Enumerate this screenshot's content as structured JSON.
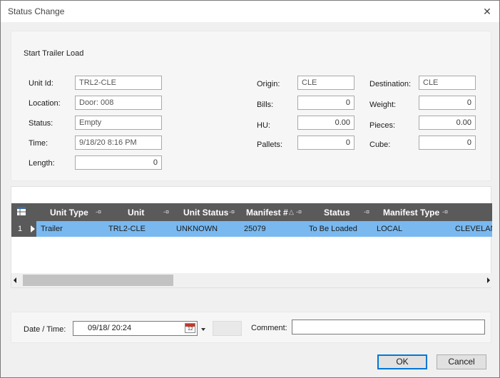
{
  "window": {
    "title": "Status Change",
    "close_glyph": "✕"
  },
  "form": {
    "section_title": "Start Trailer Load",
    "unit_id": {
      "label": "Unit Id:",
      "value": "TRL2-CLE"
    },
    "location": {
      "label": "Location:",
      "value": "Door: 008"
    },
    "status": {
      "label": "Status:",
      "value": "Empty"
    },
    "time": {
      "label": "Time:",
      "value": "9/18/20    8:16 PM"
    },
    "length": {
      "label": "Length:",
      "value": "0"
    },
    "origin": {
      "label": "Origin:",
      "value": "CLE"
    },
    "bills": {
      "label": "Bills:",
      "value": "0"
    },
    "hu": {
      "label": "HU:",
      "value": "0.00"
    },
    "pallets": {
      "label": "Pallets:",
      "value": "0"
    },
    "destination": {
      "label": "Destination:",
      "value": "CLE"
    },
    "weight": {
      "label": "Weight:",
      "value": "0"
    },
    "pieces": {
      "label": "Pieces:",
      "value": "0.00"
    },
    "cube": {
      "label": "Cube:",
      "value": "0"
    }
  },
  "grid": {
    "columns": [
      "Unit Type",
      "Unit",
      "Unit Status",
      "Manifest #",
      "Status",
      "Manifest Type"
    ],
    "sort_indicator": "△",
    "pin_glyph": "-¤",
    "rows": [
      {
        "num": "1",
        "unit_type": "Trailer",
        "unit": "TRL2-CLE",
        "unit_status": "UNKNOWN",
        "manifest": "25079",
        "status": "To Be Loaded",
        "manifest_type": "LOCAL",
        "extra": "CLEVELAND"
      }
    ]
  },
  "footer": {
    "datetime_label": "Date / Time:",
    "datetime_value": "09/18/     20:24",
    "calendar_day": "12",
    "comment_label": "Comment:",
    "comment_value": "",
    "ok_label": "OK",
    "cancel_label": "Cancel"
  },
  "colors": {
    "selected_row": "#79b9f0",
    "grid_header": "#5a5a5a",
    "accent": "#0078d7"
  }
}
